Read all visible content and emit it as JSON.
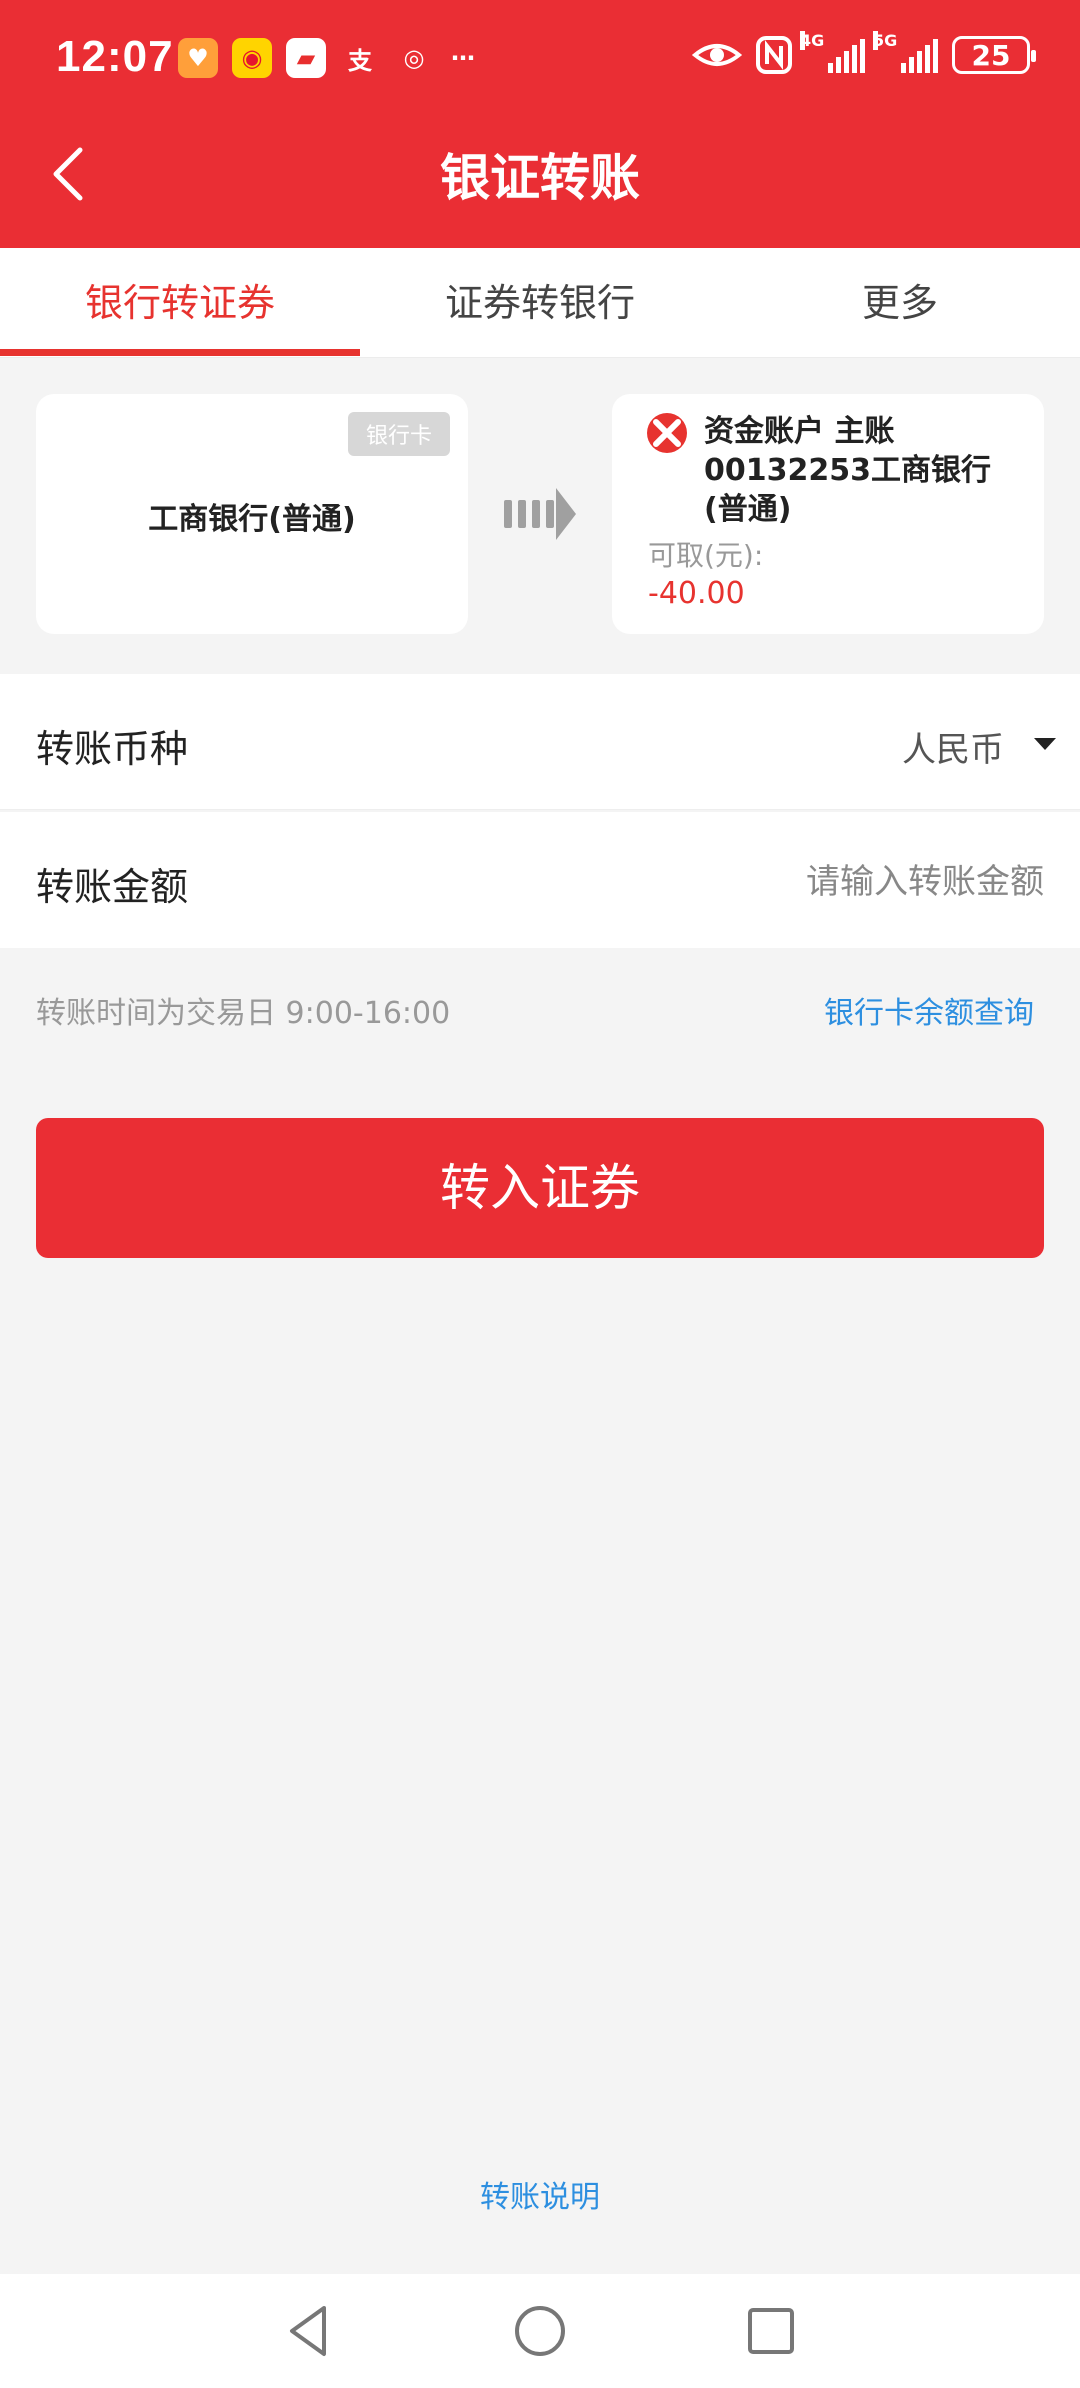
{
  "status_bar": {
    "time": "12:07",
    "icons": [
      "heart-app-icon",
      "weibo-icon",
      "reader-icon",
      "alipay-icon",
      "app-icon",
      "more-dots"
    ],
    "network_4g": "4G",
    "network_5g": "5G",
    "battery": "25"
  },
  "header": {
    "title": "银证转账",
    "back_icon": "back-chevron-icon"
  },
  "tabs": [
    {
      "label": "银行转证券",
      "active": true
    },
    {
      "label": "证券转银行",
      "active": false
    },
    {
      "label": "更多",
      "active": false
    }
  ],
  "bank_card": {
    "badge": "银行卡",
    "name": "工商银行(普通)"
  },
  "fund_account": {
    "title": "资金账户 主账 00132253工商银行(普通)",
    "available_label": "可取(元):",
    "available_value": "-40.00"
  },
  "form": {
    "currency_label": "转账币种",
    "currency_value": "人民币",
    "amount_label": "转账金额",
    "amount_placeholder": "请输入转账金额"
  },
  "hint": "转账时间为交易日 9:00-16:00",
  "balance_link": "银行卡余额查询",
  "submit_label": "转入证券",
  "footer_link": "转账说明",
  "colors": {
    "brand_red": "#ea2e34",
    "link_blue": "#2d8fe0"
  }
}
